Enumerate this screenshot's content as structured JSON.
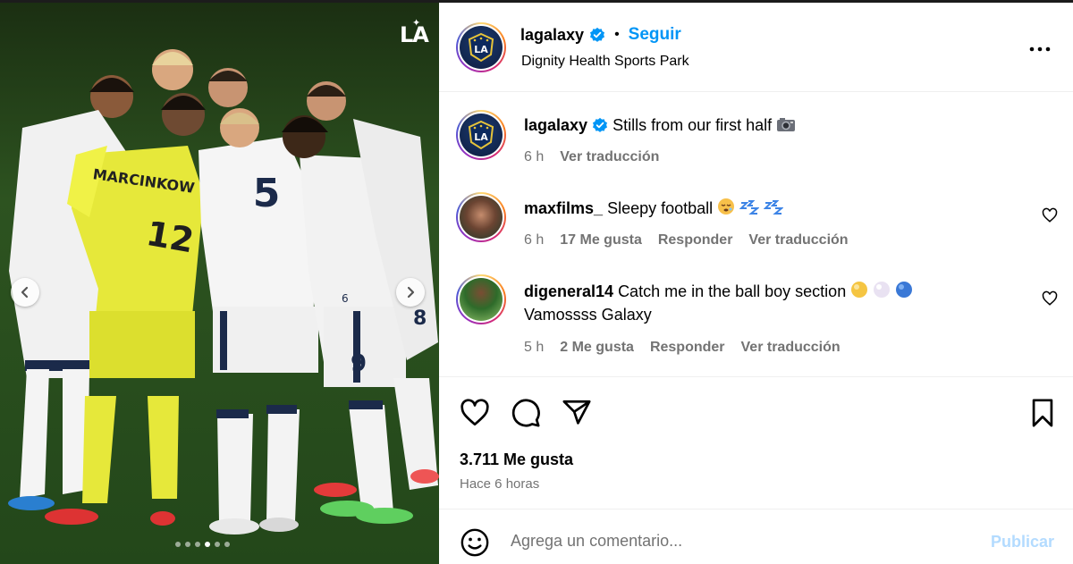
{
  "media": {
    "watermark": "LA",
    "carousel_index": 4,
    "carousel_count": 6,
    "jersey_name": "MARCINKOW",
    "jersey_numbers": [
      "12",
      "5",
      "9",
      "6",
      "8"
    ]
  },
  "post": {
    "author": "lagalaxy",
    "follow_label": "Seguir",
    "location": "Dignity Health Sports Park",
    "caption": "Stills from our first half",
    "caption_time": "6 h",
    "translate_label": "Ver traducción"
  },
  "comments": [
    {
      "user": "maxfilms_",
      "text": "Sleepy football",
      "time": "6 h",
      "likes": "17 Me gusta",
      "reply_label": "Responder",
      "translate_label": "Ver traducción"
    },
    {
      "user": "digeneral14",
      "text": "Catch me in the ball boy section",
      "text_line2": "Vamossss Galaxy",
      "time": "5 h",
      "likes": "2 Me gusta",
      "reply_label": "Responder",
      "translate_label": "Ver traducción"
    }
  ],
  "engagement": {
    "likes": "3.711 Me gusta",
    "time": "Hace 6 horas"
  },
  "comment_box": {
    "placeholder": "Agrega un comentario...",
    "publish_label": "Publicar"
  },
  "colors": {
    "accent": "#0095f6",
    "publish_disabled": "#b3dbff",
    "muted": "#737373",
    "verified": "#0095f6"
  },
  "icons": [
    "more-icon",
    "heart-icon",
    "comment-icon",
    "share-icon",
    "bookmark-icon",
    "emoji-icon",
    "verified-icon",
    "camera-icon",
    "sleepy-face-icon",
    "zzz-icon",
    "chevron-left-icon",
    "chevron-right-icon"
  ]
}
